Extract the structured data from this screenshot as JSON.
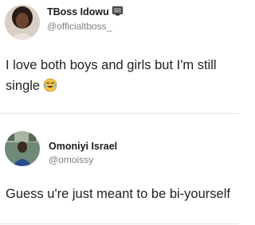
{
  "tweets": [
    {
      "author_name": "TBoss Idowu",
      "author_handle": "@officialtboss_",
      "name_badge_icon": "tv-icon",
      "text": "I love both boys and girls but I'm still single",
      "emoji_icon": "tears-of-joy-icon"
    },
    {
      "author_name": "Omoniyi Israel",
      "author_handle": "@omoissy",
      "text": "Guess u're just meant to be bi-yourself"
    }
  ]
}
